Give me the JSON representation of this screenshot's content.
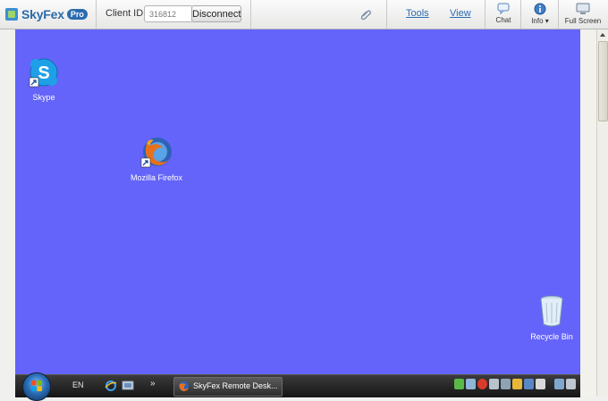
{
  "app": {
    "brand": "SkyFex",
    "edition": "Pro"
  },
  "toolbar": {
    "client_id_label": "Client ID:",
    "client_id_value": "316812",
    "disconnect_label": "Disconnect",
    "menu": [
      "Tools",
      "View"
    ],
    "buttons": [
      {
        "label": "Chat",
        "icon": "chat-icon"
      },
      {
        "label": "Info ▾",
        "icon": "info-icon"
      },
      {
        "label": "Full Screen",
        "icon": "monitor-icon"
      }
    ]
  },
  "desktop": {
    "background": "#6464fa",
    "icons": [
      {
        "label": "Skype",
        "icon": "skype-icon"
      },
      {
        "label": "Mozilla Firefox",
        "icon": "firefox-icon"
      },
      {
        "label": "Recycle Bin",
        "icon": "recycle-bin-icon"
      }
    ]
  },
  "taskbar": {
    "language": "EN",
    "overflow": "»",
    "task_label": "SkyFex Remote Desk...",
    "quick_launch": [
      "internet-explorer-icon",
      "show-desktop-icon"
    ],
    "tray_icons": [
      "network-icon",
      "security-icon",
      "error-icon",
      "printer-icon",
      "battery-icon",
      "update-icon",
      "lock-icon",
      "grid-icon",
      "display-icon",
      "volume-muted-icon"
    ]
  }
}
